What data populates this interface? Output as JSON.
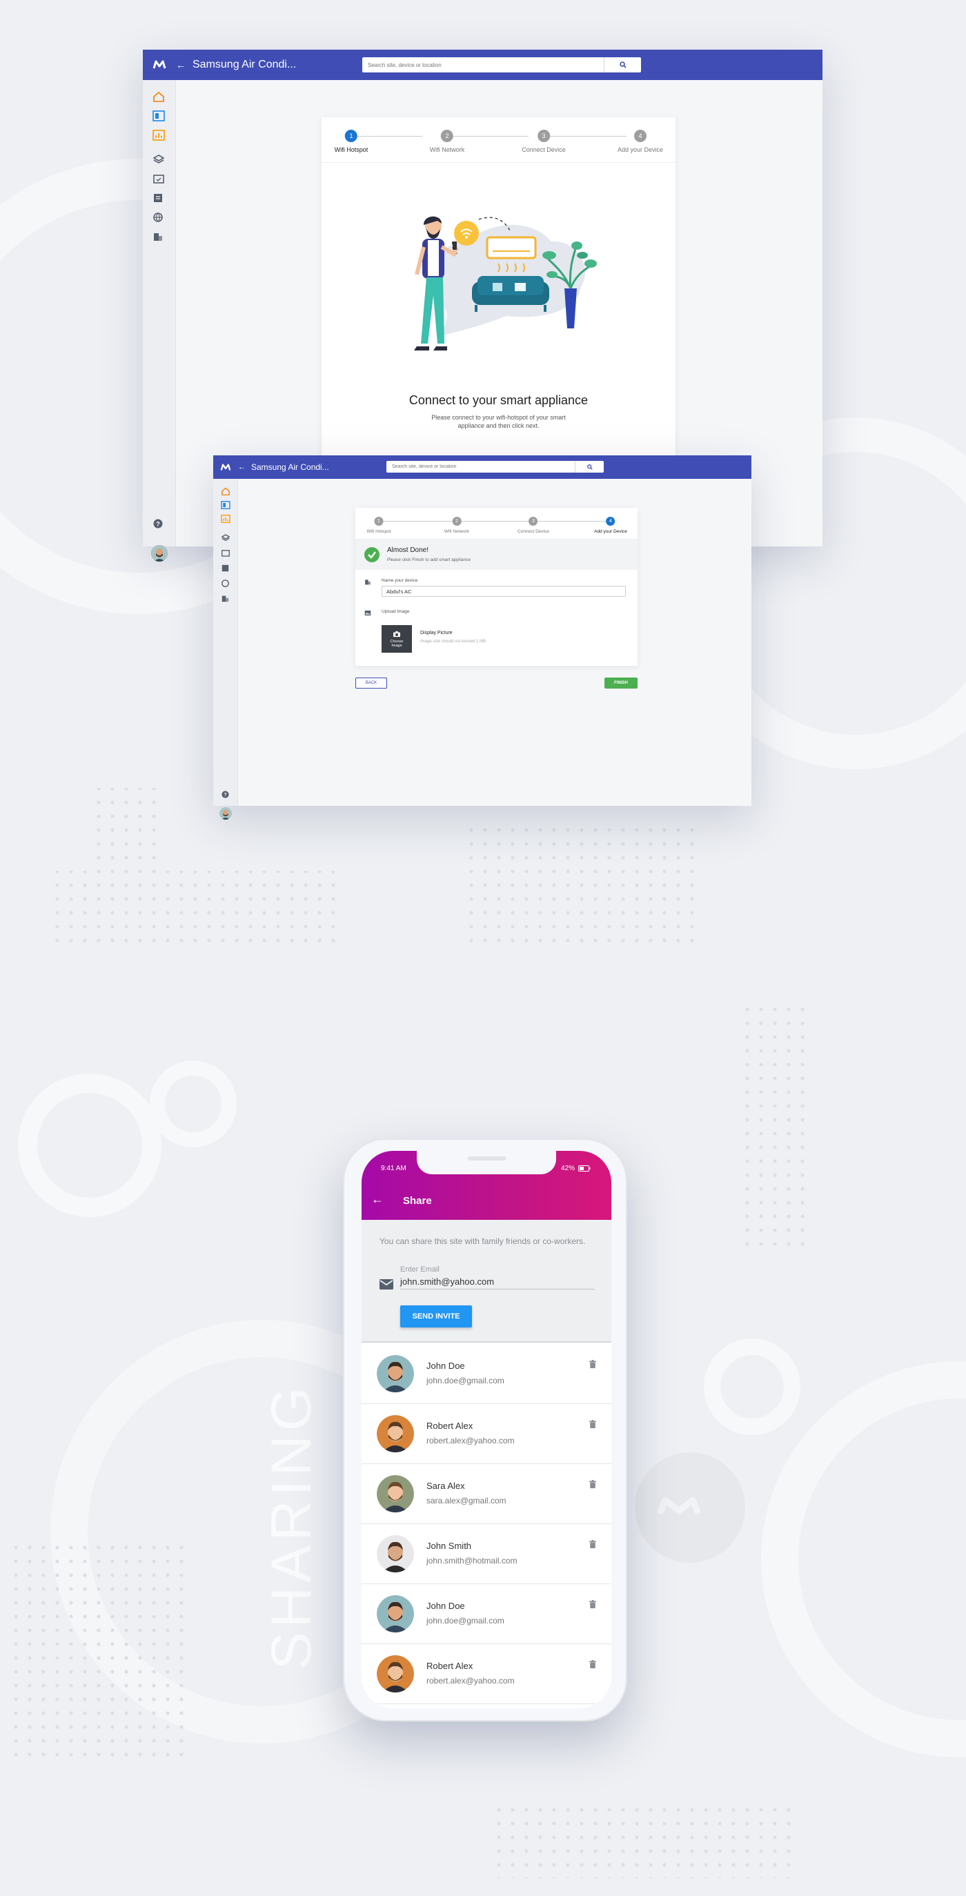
{
  "brand": {
    "accent": "#3f4db4",
    "phone_gradient": [
      "#a50aa8",
      "#d8177b"
    ],
    "success": "#4caf50",
    "primary_button": "#2196f3"
  },
  "window1": {
    "title": "Samsung Air Condi...",
    "search_placeholder": "Search site, device or location",
    "steps": [
      {
        "num": "1",
        "label": "Wifi Hotspot",
        "active": true
      },
      {
        "num": "2",
        "label": "Wifi Network",
        "active": false
      },
      {
        "num": "3",
        "label": "Connect Device",
        "active": false
      },
      {
        "num": "4",
        "label": "Add your Device",
        "active": false
      }
    ],
    "heading": "Connect to your smart appliance",
    "subtext": "Please connect to your wifi-hotspot of your smart appliance and then click next."
  },
  "window2": {
    "title": "Samsung Air Condi...",
    "search_placeholder": "Search site, device or location",
    "steps": [
      {
        "num": "1",
        "label": "Wifi Hotspot",
        "active": false
      },
      {
        "num": "2",
        "label": "Wifi Network",
        "active": false
      },
      {
        "num": "3",
        "label": "Connect Device",
        "active": false
      },
      {
        "num": "4",
        "label": "Add your Device",
        "active": true
      }
    ],
    "done_title": "Almost Done!",
    "done_sub": "Please click Finish to add smart appliance",
    "name_label": "Name your device",
    "name_value": "Abdul's AC",
    "upload_label": "Upload Image",
    "choose_image": "Choose Image",
    "display_picture": "Display Picture",
    "image_hint": "Image size should not exceed 1 MB",
    "back_button": "BACK",
    "finish_button": "FINISH"
  },
  "phone": {
    "time": "9:41 AM",
    "battery": "42%",
    "title": "Share",
    "description": "You can share this site  with family friends or co-workers.",
    "email_label": "Enter Email",
    "email_value": "john.smith@yahoo.com",
    "send_button": "SEND INVITE",
    "contacts": [
      {
        "name": "John Doe",
        "email": "john.doe@gmail.com"
      },
      {
        "name": "Robert Alex",
        "email": "robert.alex@yahoo.com"
      },
      {
        "name": "Sara Alex",
        "email": "sara.alex@gmail.com"
      },
      {
        "name": "John Smith",
        "email": "john.smith@hotmail.com"
      },
      {
        "name": "John Doe",
        "email": "john.doe@gmail.com"
      },
      {
        "name": "Robert Alex",
        "email": "robert.alex@yahoo.com"
      }
    ]
  },
  "section_label": "SHARING"
}
